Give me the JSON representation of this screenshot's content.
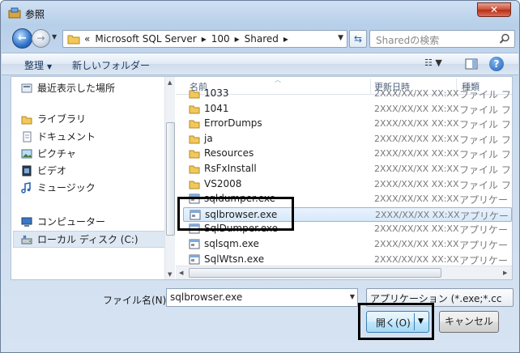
{
  "window": {
    "title": "参照",
    "close_glyph": "✕"
  },
  "nav": {
    "back_glyph": "←",
    "forward_glyph": "→",
    "breadcrumb": [
      "«",
      "Microsoft SQL Server",
      "▸",
      "100",
      "▸",
      "Shared",
      "▸"
    ],
    "search_placeholder": "Sharedの検索"
  },
  "toolbar": {
    "organize": "整理",
    "organize_arrow": "▼",
    "new_folder": "新しいフォルダー",
    "help": "?"
  },
  "sidebar": [
    {
      "label": "最近表示した場所",
      "icon": "recent-places-icon"
    },
    {
      "label": "ライブラリ",
      "icon": "library-icon"
    },
    {
      "label": "ドキュメント",
      "icon": "document-icon"
    },
    {
      "label": "ピクチャ",
      "icon": "picture-icon"
    },
    {
      "label": "ビデオ",
      "icon": "video-icon"
    },
    {
      "label": "ミュージック",
      "icon": "music-icon"
    },
    {
      "label": "コンピューター",
      "icon": "computer-icon"
    },
    {
      "label": "ローカル ディスク (C:)",
      "icon": "local-disk-icon"
    }
  ],
  "columns": {
    "name": "名前",
    "date": "更新日時",
    "type": "種類"
  },
  "files": [
    {
      "name": "1033",
      "date": "2XXX/XX/XX XX:XX",
      "type": "ファイル フ",
      "kind": "folder"
    },
    {
      "name": "1041",
      "date": "2XXX/XX/XX XX:XX",
      "type": "ファイル フ",
      "kind": "folder"
    },
    {
      "name": "ErrorDumps",
      "date": "2XXX/XX/XX XX:XX",
      "type": "ファイル フ",
      "kind": "folder"
    },
    {
      "name": "ja",
      "date": "2XXX/XX/XX XX:XX",
      "type": "ファイル フ",
      "kind": "folder"
    },
    {
      "name": "Resources",
      "date": "2XXX/XX/XX XX:XX",
      "type": "ファイル フ",
      "kind": "folder"
    },
    {
      "name": "RsFxInstall",
      "date": "2XXX/XX/XX XX:XX",
      "type": "ファイル フ",
      "kind": "folder"
    },
    {
      "name": "VS2008",
      "date": "2XXX/XX/XX XX:XX",
      "type": "ファイル フ",
      "kind": "folder"
    },
    {
      "name": "sqldumper.exe",
      "date": "2XXX/XX/XX XX:XX",
      "type": "アプリケー",
      "kind": "exe"
    },
    {
      "name": "sqlbrowser.exe",
      "date": "2XXX/XX/XX XX:XX",
      "type": "アプリケー",
      "kind": "exe",
      "selected": true
    },
    {
      "name": "SqlDumper.exe",
      "date": "2XXX/XX/XX XX:XX",
      "type": "アプリケー",
      "kind": "exe"
    },
    {
      "name": "sqlsqm.exe",
      "date": "2XXX/XX/XX XX:XX",
      "type": "アプリケー",
      "kind": "exe"
    },
    {
      "name": "SqlWtsn.exe",
      "date": "2XXX/XX/XX XX:XX",
      "type": "アプリケー",
      "kind": "exe"
    }
  ],
  "footer": {
    "filename_label": "ファイル名(N):",
    "filename_value": "sqlbrowser.exe",
    "filter_value": "アプリケーション (*.exe;*.cc",
    "open_label": "開く(O)",
    "cancel_label": "キャンセル"
  },
  "colors": {
    "selection": "#d6e8fa",
    "accent": "#3c7fb1"
  }
}
